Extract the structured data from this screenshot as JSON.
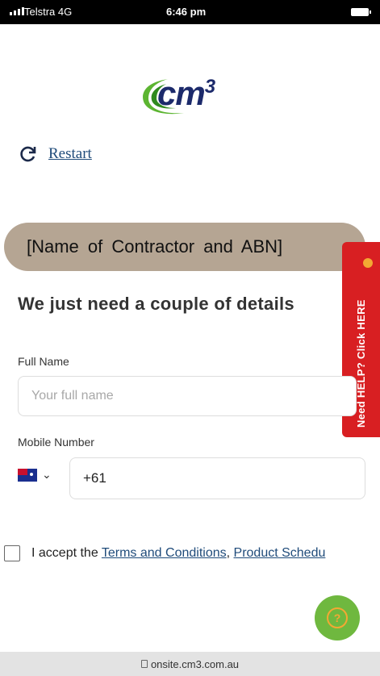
{
  "status_bar": {
    "carrier": "Telstra 4G",
    "time": "6:46 pm"
  },
  "logo": {
    "text": "cm",
    "superscript": "3"
  },
  "restart": {
    "label": "Restart"
  },
  "banner": {
    "text": "[Name of Contractor and ABN]"
  },
  "help_tab": {
    "label": "Need HELP? Click HERE"
  },
  "form": {
    "heading": "We just need a couple of details",
    "full_name_label": "Full Name",
    "full_name_placeholder": "Your full name",
    "mobile_label": "Mobile Number",
    "mobile_value": "+61",
    "accept_prefix": "I accept the",
    "terms_link": "Terms and Conditions",
    "product_link": "Product Schedu"
  },
  "url_bar": {
    "url": "onsite.cm3.com.au"
  },
  "colors": {
    "banner_bg": "#b5a593",
    "help_tab": "#d81f22",
    "fab": "#6fb83f",
    "link": "#1f4b7a"
  }
}
